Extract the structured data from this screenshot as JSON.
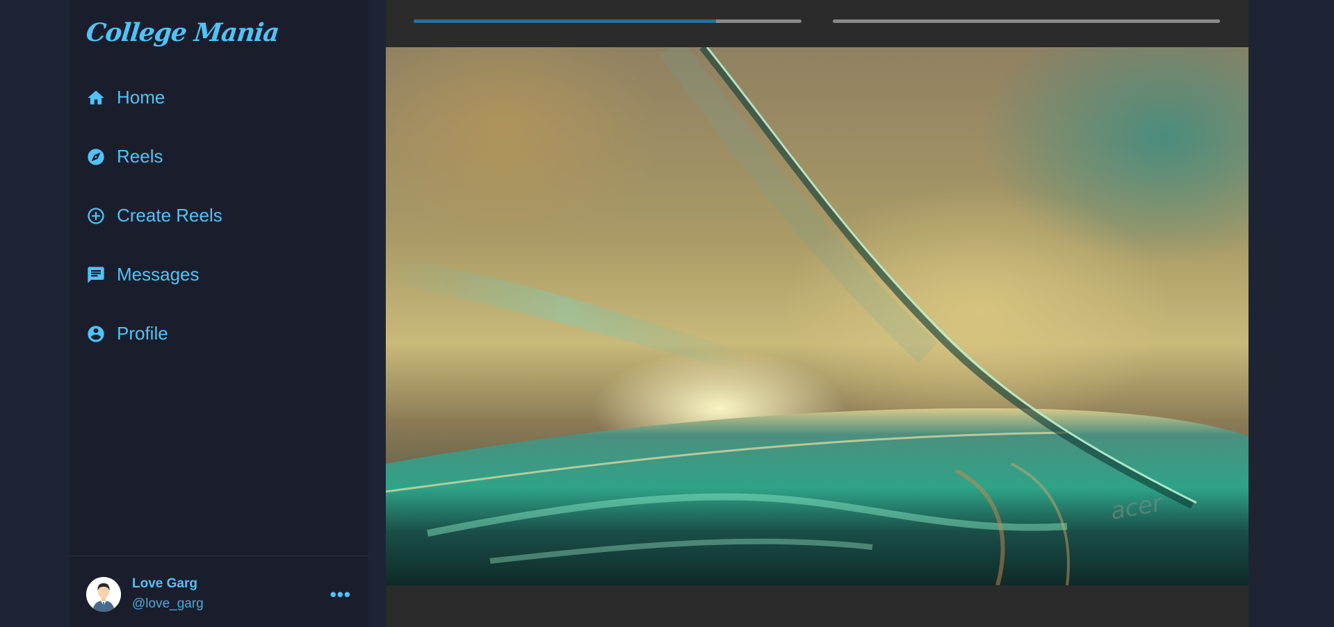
{
  "app": {
    "logo": "College Mania"
  },
  "nav": {
    "items": [
      {
        "label": "Home",
        "icon": "home-icon"
      },
      {
        "label": "Reels",
        "icon": "compass-icon"
      },
      {
        "label": "Create Reels",
        "icon": "add-circle-icon"
      },
      {
        "label": "Messages",
        "icon": "message-icon"
      },
      {
        "label": "Profile",
        "icon": "account-circle-icon"
      }
    ]
  },
  "user": {
    "name": "Love Garg",
    "handle": "@love_garg",
    "avatar": "avatar-icon",
    "more": "•••"
  },
  "story": {
    "progress": [
      0.78,
      0.0
    ]
  },
  "colors": {
    "accent": "#4fc3f7",
    "sidebar_bg": "#1a1e2c",
    "page_bg": "#1f2435",
    "viewer_bg": "#2b2b2b",
    "progress_fill": "#2a6f97",
    "progress_track": "#8a8a8a"
  }
}
